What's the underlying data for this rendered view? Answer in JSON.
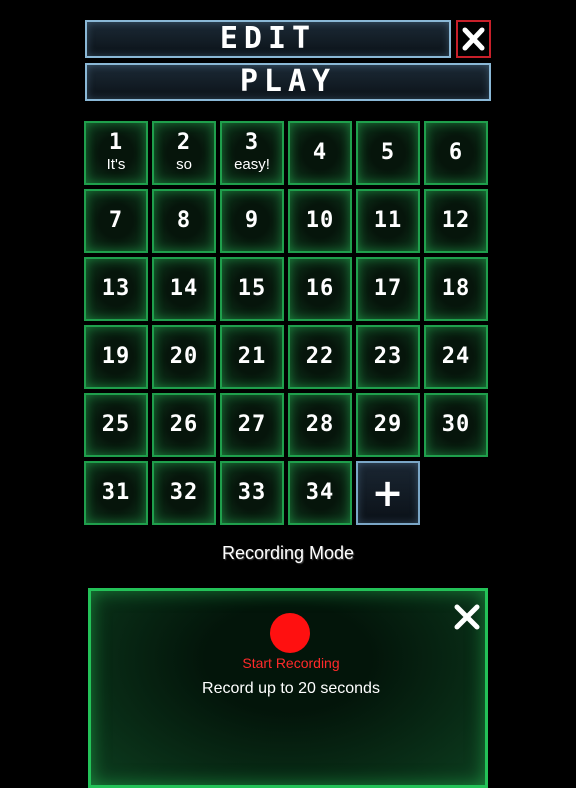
{
  "header": {
    "edit_label": "EDIT",
    "play_label": "PLAY",
    "close_icon": "close-icon"
  },
  "grid": {
    "items": [
      {
        "number": "1",
        "caption": "It's"
      },
      {
        "number": "2",
        "caption": "so"
      },
      {
        "number": "3",
        "caption": "easy!"
      },
      {
        "number": "4"
      },
      {
        "number": "5"
      },
      {
        "number": "6"
      },
      {
        "number": "7"
      },
      {
        "number": "8"
      },
      {
        "number": "9"
      },
      {
        "number": "10"
      },
      {
        "number": "11"
      },
      {
        "number": "12"
      },
      {
        "number": "13"
      },
      {
        "number": "14"
      },
      {
        "number": "15"
      },
      {
        "number": "16"
      },
      {
        "number": "17"
      },
      {
        "number": "18"
      },
      {
        "number": "19"
      },
      {
        "number": "20"
      },
      {
        "number": "21"
      },
      {
        "number": "22"
      },
      {
        "number": "23"
      },
      {
        "number": "24"
      },
      {
        "number": "25"
      },
      {
        "number": "26"
      },
      {
        "number": "27"
      },
      {
        "number": "28"
      },
      {
        "number": "29"
      },
      {
        "number": "30"
      },
      {
        "number": "31"
      },
      {
        "number": "32"
      },
      {
        "number": "33"
      },
      {
        "number": "34"
      }
    ],
    "add_label": "+"
  },
  "recording": {
    "mode_label": "Recording Mode",
    "start_label": "Start Recording",
    "description": "Record up to 20 seconds",
    "close_icon": "close-icon",
    "record_icon": "record-icon"
  },
  "colors": {
    "background": "#000000",
    "cell_border": "#1f9f4c",
    "panel_border": "#23c258",
    "record_red": "#ff1010",
    "accent_blue": "#8ab8d6",
    "close_red": "#c8202a"
  }
}
